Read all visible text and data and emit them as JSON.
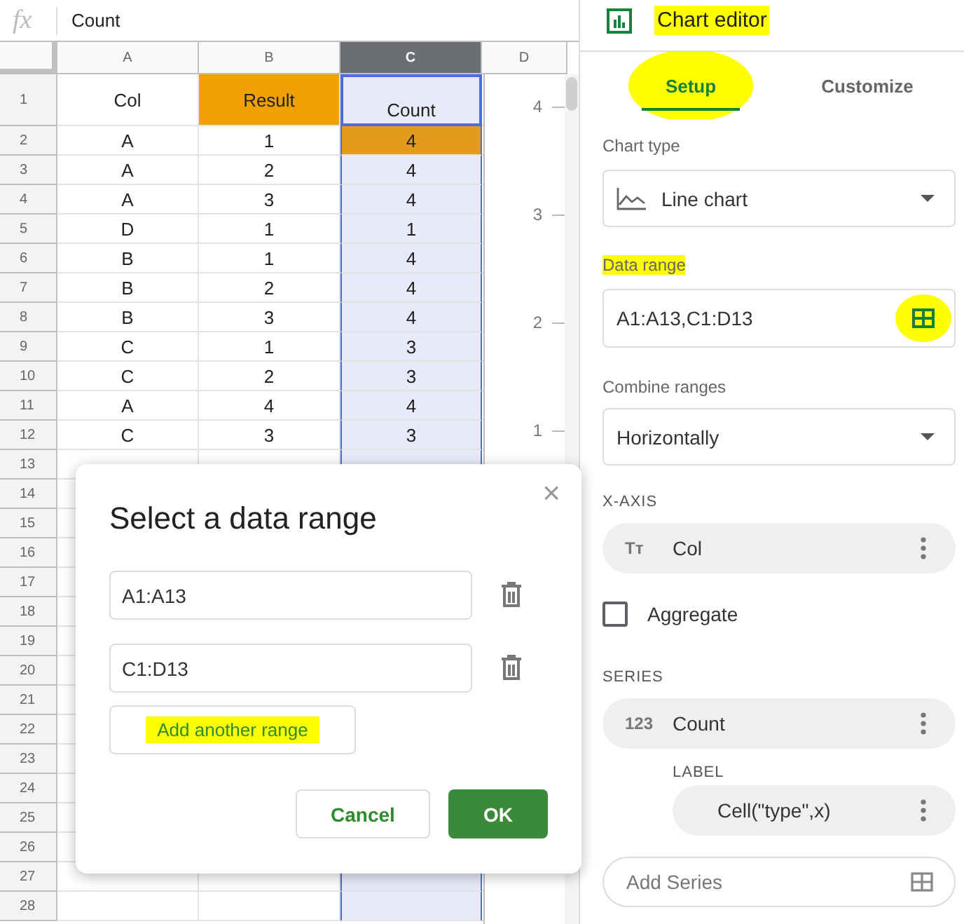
{
  "formula_bar": {
    "icon": "fx",
    "value": "Count"
  },
  "sheet": {
    "columns": [
      {
        "label": "A",
        "selected": false
      },
      {
        "label": "B",
        "selected": false
      },
      {
        "label": "C",
        "selected": true
      },
      {
        "label": "D",
        "selected": false
      }
    ],
    "rows": [
      {
        "number": "1",
        "cells": [
          {
            "text": "Col"
          },
          {
            "text": "Result",
            "color": "#f0a000"
          },
          {
            "text": "Count"
          }
        ]
      },
      {
        "number": "2",
        "cells": [
          {
            "text": "A"
          },
          {
            "text": "1"
          },
          {
            "text": "4",
            "color": "#e39b1e"
          }
        ]
      },
      {
        "number": "3",
        "cells": [
          {
            "text": "A"
          },
          {
            "text": "2"
          },
          {
            "text": "4"
          }
        ]
      },
      {
        "number": "4",
        "cells": [
          {
            "text": "A"
          },
          {
            "text": "3"
          },
          {
            "text": "4"
          }
        ]
      },
      {
        "number": "5",
        "cells": [
          {
            "text": "D"
          },
          {
            "text": "1"
          },
          {
            "text": "1"
          }
        ]
      },
      {
        "number": "6",
        "cells": [
          {
            "text": "B"
          },
          {
            "text": "1"
          },
          {
            "text": "4"
          }
        ]
      },
      {
        "number": "7",
        "cells": [
          {
            "text": "B"
          },
          {
            "text": "2"
          },
          {
            "text": "4"
          }
        ]
      },
      {
        "number": "8",
        "cells": [
          {
            "text": "B"
          },
          {
            "text": "3"
          },
          {
            "text": "4"
          }
        ]
      },
      {
        "number": "9",
        "cells": [
          {
            "text": "C"
          },
          {
            "text": "1"
          },
          {
            "text": "3"
          }
        ]
      },
      {
        "number": "10",
        "cells": [
          {
            "text": "C"
          },
          {
            "text": "2"
          },
          {
            "text": "3"
          }
        ]
      },
      {
        "number": "11",
        "cells": [
          {
            "text": "A"
          },
          {
            "text": "4"
          },
          {
            "text": "4"
          }
        ]
      },
      {
        "number": "12",
        "cells": [
          {
            "text": "C"
          },
          {
            "text": "3"
          },
          {
            "text": "3"
          }
        ]
      },
      {
        "number": "13"
      },
      {
        "number": "14"
      },
      {
        "number": "15"
      },
      {
        "number": "16"
      },
      {
        "number": "17"
      },
      {
        "number": "18"
      },
      {
        "number": "19"
      },
      {
        "number": "20"
      },
      {
        "number": "21"
      },
      {
        "number": "22"
      },
      {
        "number": "23"
      },
      {
        "number": "24"
      },
      {
        "number": "25"
      },
      {
        "number": "26"
      },
      {
        "number": "27"
      },
      {
        "number": "28"
      }
    ]
  },
  "chart_preview": {
    "axis_labels": [
      "4",
      "3",
      "2",
      "1"
    ]
  },
  "dialog": {
    "title": "Select a data range",
    "close": "×",
    "ranges": [
      {
        "value": "A1:A13"
      },
      {
        "value": "C1:D13"
      }
    ],
    "add_button": {
      "label": "Add another range",
      "highlighted": true
    },
    "cancel": "Cancel",
    "ok": "OK"
  },
  "panel": {
    "title": "Chart editor",
    "title_highlighted": true,
    "tabs": [
      {
        "label": "Setup",
        "selected": true,
        "highlighted": true
      },
      {
        "label": "Customize",
        "selected": false,
        "highlighted": false
      }
    ],
    "chart_type": {
      "label": "Chart type",
      "value": "Line chart"
    },
    "data_range": {
      "label": "Data range",
      "label_highlighted": true,
      "value": "A1:A13,C1:D13",
      "icon_highlighted": true
    },
    "combine": {
      "label": "Combine ranges",
      "value": "Horizontally"
    },
    "x_axis": {
      "heading": "X-AXIS",
      "icon": "Tт",
      "value": "Col"
    },
    "aggregate": {
      "label": "Aggregate",
      "checked": false
    },
    "series": {
      "heading": "SERIES",
      "icon": "123",
      "value": "Count",
      "label_heading": "LABEL",
      "label_value": "Cell(\"type\",x)"
    },
    "add_series": {
      "placeholder": "Add Series"
    }
  }
}
